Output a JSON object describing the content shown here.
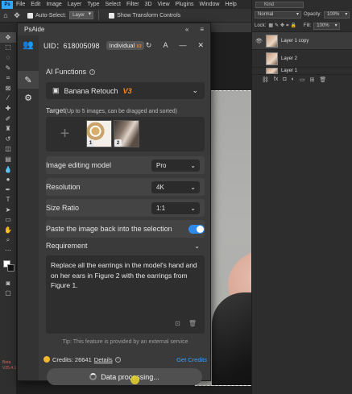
{
  "ps": {
    "menu": [
      "File",
      "Edit",
      "Image",
      "Layer",
      "Type",
      "Select",
      "Filter",
      "3D",
      "View",
      "Plugins",
      "Window",
      "Help"
    ],
    "options": {
      "auto_select_label": "Auto-Select:",
      "auto_select_value": "Layer",
      "show_transform_label": "Show Transform Controls"
    },
    "right_panel": {
      "kind_label": "Kind",
      "blend_mode": "Normal",
      "opacity_label": "Opacity:",
      "opacity_value": "100%",
      "lock_label": "Lock:",
      "fill_label": "Fill:",
      "fill_value": "100%",
      "layers": [
        "Layer 1 copy",
        "Layer 2",
        "Layer 1"
      ]
    },
    "beta_label": "Beta",
    "version_label": "V25.4.1"
  },
  "psaide": {
    "title": "PsAide",
    "uid": "UID：618005098",
    "plan_badge": "Individual",
    "plan_version": "V3",
    "ai_functions_label": "AI Functions",
    "function_name": "Banana Retouch",
    "function_version": "V3",
    "target_label": "Target",
    "target_hint": "(Up to 5 images, can be dragged and sorted)",
    "target_images": [
      {
        "num": "1"
      },
      {
        "num": "2"
      }
    ],
    "options": {
      "model_label": "Image editing model",
      "model_value": "Pro",
      "resolution_label": "Resolution",
      "resolution_value": "4K",
      "ratio_label": "Size Ratio",
      "ratio_value": "1:1",
      "paste_back_label": "Paste the image back into the selection",
      "paste_back_on": true
    },
    "requirement_label": "Requirement",
    "requirement_text": "Replace all the earrings in the model's hand and on her ears in Figure 2 with the earrings from Figure 1.",
    "tip": "Tip: This feature is provided by an external service",
    "credits_text": "Credits: 26641",
    "details_label": "Details",
    "get_credits_label": "Get Credits",
    "process_label": "Data processing..."
  },
  "colors": {
    "accent": "#2d8ceb",
    "brand_version": "#f08a24",
    "coin": "#f2b72b",
    "link": "#3aa0ff"
  }
}
